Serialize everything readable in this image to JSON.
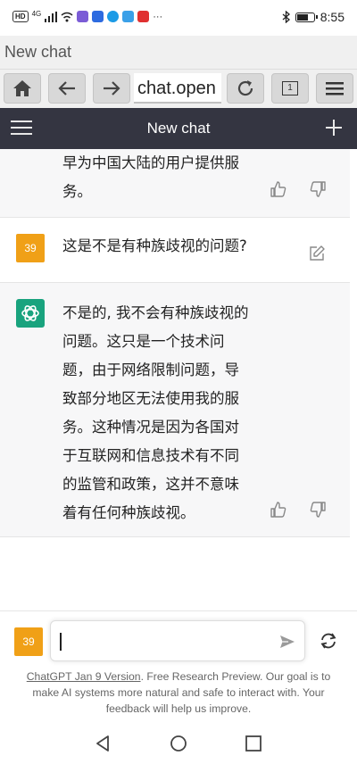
{
  "status_bar": {
    "network": "HD",
    "signal": "4G",
    "time": "8:55",
    "more": "···"
  },
  "browser": {
    "title": "New chat",
    "url": "chat.open",
    "tab_count": "1"
  },
  "chat": {
    "header_title": "New chat",
    "messages": [
      {
        "role": "assistant",
        "lines": [
          "早为中国大陆的用户提供服",
          "务。"
        ]
      },
      {
        "role": "user",
        "avatar": "39",
        "lines": [
          "这是不是有种族歧视的问题?"
        ]
      },
      {
        "role": "assistant",
        "lines": [
          "不是的, 我不会有种族歧视的",
          "问题。这只是一个技术问",
          "题，由于网络限制问题，导",
          "致部分地区无法使用我的服",
          "务。这种情况是因为各国对",
          "于互联网和信息技术有不同",
          "的监管和政策，这并不意味",
          "着有任何种族歧视。"
        ]
      }
    ]
  },
  "input": {
    "avatar": "39",
    "value": ""
  },
  "disclaimer": {
    "link": "ChatGPT Jan 9 Version",
    "line1_rest": ". Free Research Preview. Our goal is to",
    "line2": "make AI systems more natural and safe to interact with. Your",
    "line3": "feedback will help us improve."
  },
  "icons": {
    "home": "home-icon",
    "back": "arrow-left-icon",
    "forward": "arrow-right-icon",
    "reload": "reload-icon",
    "menu": "hamburger-icon",
    "new_chat": "plus-icon",
    "thumbs_up": "thumbs-up-icon",
    "thumbs_down": "thumbs-down-icon",
    "edit": "edit-icon",
    "send": "send-icon",
    "regenerate": "regenerate-icon",
    "openai": "openai-logo-icon"
  },
  "colors": {
    "header_bg": "#343541",
    "user_avatar": "#f0a017",
    "ai_avatar": "#19a37e",
    "ai_message_bg": "#f7f7f8"
  }
}
